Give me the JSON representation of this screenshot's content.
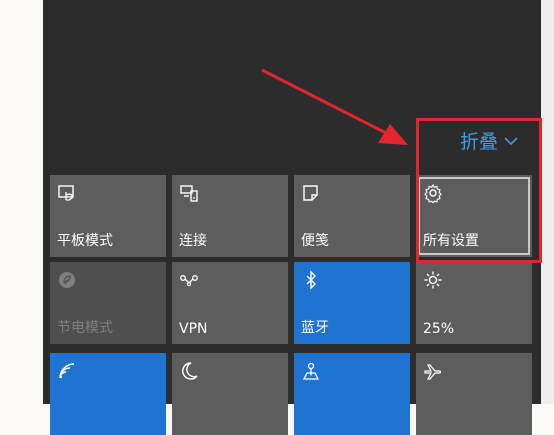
{
  "panel": {
    "collapse_label": "折叠",
    "collapse_icon": "chevron-down-icon"
  },
  "tiles": [
    {
      "id": "tablet-mode",
      "label": "平板模式",
      "icon": "tablet-mode-icon",
      "state": "normal"
    },
    {
      "id": "connect",
      "label": "连接",
      "icon": "connect-icon",
      "state": "normal"
    },
    {
      "id": "note",
      "label": "便笺",
      "icon": "note-icon",
      "state": "normal"
    },
    {
      "id": "all-settings",
      "label": "所有设置",
      "icon": "gear-icon",
      "state": "selected"
    },
    {
      "id": "battery-saver",
      "label": "节电模式",
      "icon": "battery-saver-icon",
      "state": "disabled"
    },
    {
      "id": "vpn",
      "label": "VPN",
      "icon": "vpn-icon",
      "state": "normal"
    },
    {
      "id": "bluetooth",
      "label": "蓝牙",
      "icon": "bluetooth-icon",
      "state": "active"
    },
    {
      "id": "brightness",
      "label": "25%",
      "icon": "brightness-icon",
      "state": "normal"
    },
    {
      "id": "wifi",
      "label": "",
      "icon": "wifi-icon",
      "state": "active"
    },
    {
      "id": "quiet-hours",
      "label": "",
      "icon": "moon-icon",
      "state": "normal"
    },
    {
      "id": "location",
      "label": "",
      "icon": "location-icon",
      "state": "active"
    },
    {
      "id": "airplane-mode",
      "label": "",
      "icon": "airplane-icon",
      "state": "normal"
    }
  ],
  "annotation": {
    "arrow_color": "#e3262e",
    "box_color": "#e3262e"
  },
  "colors": {
    "panel_bg": "#2c2c2c",
    "tile_bg": "#5d5d5d",
    "tile_active": "#1f74d1",
    "accent_link": "#3e9ee6"
  }
}
